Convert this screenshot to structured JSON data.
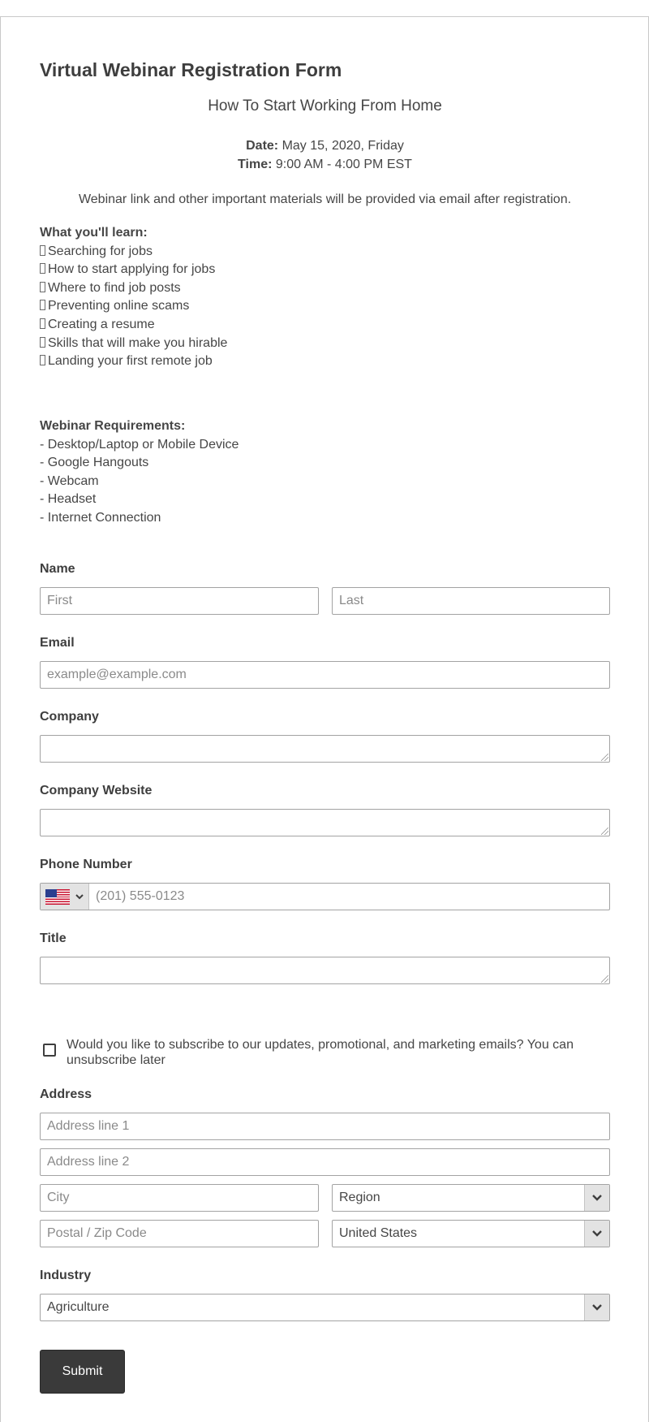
{
  "form": {
    "title": "Virtual Webinar Registration Form",
    "subtitle": "How To Start Working From Home",
    "date_label": "Date:",
    "date_value": "May 15, 2020, Friday",
    "time_label": "Time:",
    "time_value": "9:00 AM - 4:00 PM EST",
    "intro": "Webinar link and other important materials will be provided via email after registration."
  },
  "learn": {
    "heading": "What you'll learn:",
    "items": [
      "Searching for jobs",
      "How to start applying for jobs",
      "Where to find job posts",
      "Preventing online scams",
      "Creating a resume",
      "Skills that will make you hirable",
      "Landing your first remote job"
    ]
  },
  "requirements": {
    "heading": "Webinar Requirements:",
    "items": [
      "- Desktop/Laptop or Mobile Device",
      "- Google Hangouts",
      "- Webcam",
      "- Headset",
      "- Internet Connection"
    ]
  },
  "fields": {
    "name_label": "Name",
    "first_placeholder": "First",
    "last_placeholder": "Last",
    "email_label": "Email",
    "email_placeholder": "example@example.com",
    "company_label": "Company",
    "company_website_label": "Company Website",
    "phone_label": "Phone Number",
    "phone_placeholder": "(201) 555-0123",
    "phone_country_icon": "us-flag-icon",
    "title_label": "Title",
    "subscribe_text": "Would you like to subscribe to our updates, promotional, and marketing emails? You can unsubscribe later",
    "subscribe_checked": false,
    "address_label": "Address",
    "address1_placeholder": "Address line 1",
    "address2_placeholder": "Address line 2",
    "city_placeholder": "City",
    "region_value": "Region",
    "postal_placeholder": "Postal / Zip Code",
    "country_value": "United States",
    "industry_label": "Industry",
    "industry_value": "Agriculture"
  },
  "submit_label": "Submit",
  "colors": {
    "button_bg": "#3a3a3a",
    "border": "#a3a3a3",
    "select_arrow_bg": "#e3e3e3"
  }
}
